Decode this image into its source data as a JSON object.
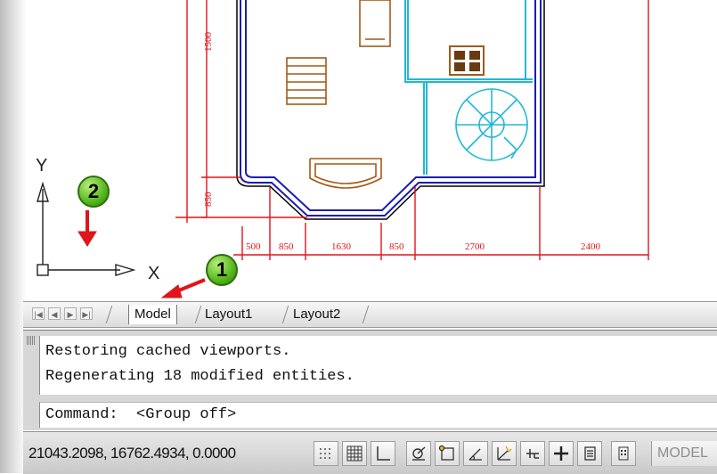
{
  "drawing": {
    "dimensions_bottom": [
      "500",
      "850",
      "1630",
      "850",
      "2700",
      "2400"
    ],
    "dimensions_left": [
      "1500",
      "850"
    ],
    "ucs": {
      "x_label": "X",
      "y_label": "Y"
    }
  },
  "callouts": [
    {
      "number": "1",
      "target": "Model tab"
    },
    {
      "number": "2",
      "target": "UCS icon"
    }
  ],
  "tabs": {
    "nav_buttons": [
      "|◀",
      "◀",
      "▶",
      "▶|"
    ],
    "items": [
      {
        "label": "Model",
        "active": true
      },
      {
        "label": "Layout1",
        "active": false
      },
      {
        "label": "Layout2",
        "active": false
      }
    ]
  },
  "command": {
    "history": [
      "Restoring cached viewports.",
      "Regenerating 18 modified entities."
    ],
    "prompt": "Command:  <Group off>"
  },
  "status": {
    "coordinates": "21043.2098, 16762.4934, 0.0000",
    "toggles": [
      {
        "name": "infer-constraints-icon"
      },
      {
        "name": "snap-mode-icon"
      },
      {
        "name": "grid-display-icon"
      },
      {
        "name": "ortho-mode-icon"
      },
      {
        "name": "polar-tracking-icon"
      },
      {
        "name": "object-snap-icon"
      },
      {
        "name": "object-snap-tracking-icon"
      },
      {
        "name": "dynamic-ucs-icon"
      },
      {
        "name": "dynamic-input-icon"
      },
      {
        "name": "lineweight-icon"
      },
      {
        "name": "quick-properties-icon"
      }
    ],
    "model_label": "MODEL"
  },
  "colors": {
    "wall": "#1c1cb4",
    "dimension": "#e0141b",
    "furniture": "#a35a17",
    "interior": "#21b8d6",
    "callout": "#53b81c"
  }
}
